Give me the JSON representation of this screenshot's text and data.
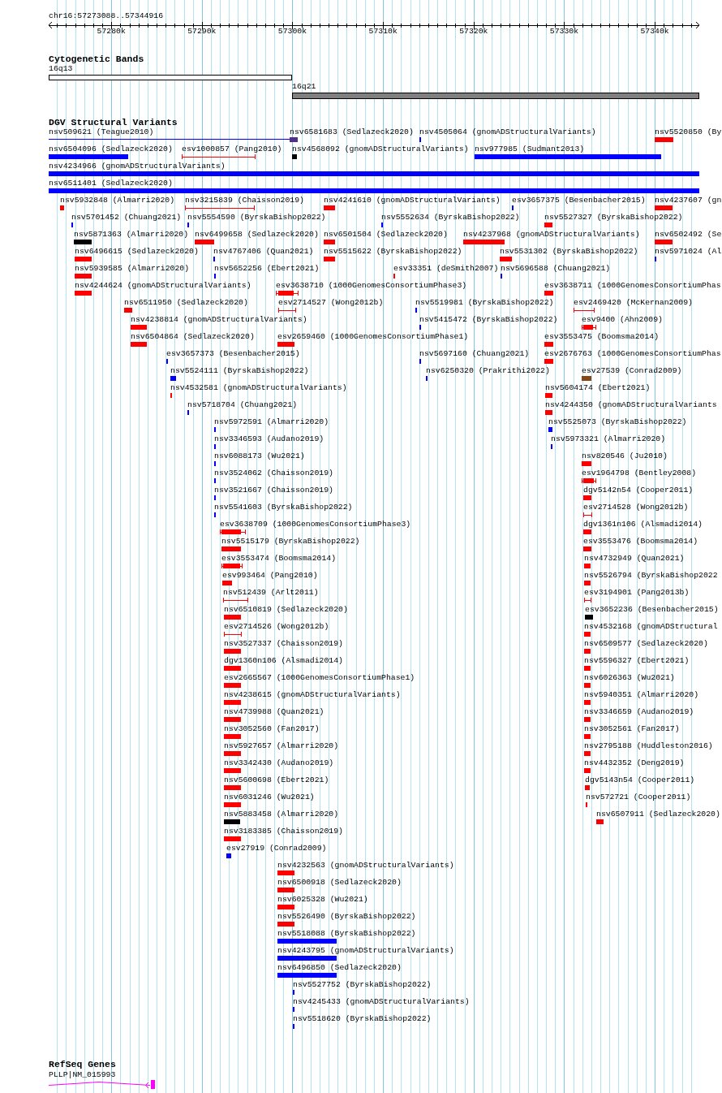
{
  "location": "chr16:57273088..57344916",
  "ruler": {
    "ticks": [
      "57280k",
      "57290k",
      "57300k",
      "57310k",
      "57320k",
      "57330k",
      "57340k"
    ]
  },
  "tracks": [
    {
      "kind": "bands",
      "title": "Cytogenetic Bands",
      "bands": [
        {
          "label": "16q13",
          "color": "#ffffff"
        },
        {
          "label": "16q21",
          "color": "#808080"
        }
      ]
    },
    {
      "kind": "variants",
      "title": "DGV Structural Variants",
      "features": [
        {
          "label": "nsv509621 (Teague2010)",
          "kind": "line",
          "color": "#0000ff"
        },
        {
          "label": "nsv6581683 (Sedlazeck2020)",
          "kind": "block",
          "color": "#50308c"
        },
        {
          "label": "nsv4505064 (gnomADStructuralVariants)",
          "kind": "block",
          "color": "#0000ff"
        },
        {
          "label": "nsv5520850 (By",
          "kind": "block",
          "color": "#ff0000"
        },
        {
          "label": "nsv6504096 (Sedlazeck2020)",
          "kind": "block",
          "color": "#0000ff"
        },
        {
          "label": "esv1000857 (Pang2010)",
          "kind": "interval",
          "color": "#ff0000"
        },
        {
          "label": "nsv4568092 (gnomADStructuralVariants)",
          "kind": "block",
          "color": "#000000"
        },
        {
          "label": "nsv977985 (Sudmant2013)",
          "kind": "block",
          "color": "#0000ff"
        },
        {
          "label": "nsv4234966 (gnomADStructuralVariants)",
          "kind": "block",
          "color": "#0000ff"
        },
        {
          "label": "nsv6511401 (Sedlazeck2020)",
          "kind": "block",
          "color": "#0000ff"
        },
        {
          "label": "nsv5932848 (Almarri2020)",
          "kind": "block",
          "color": "#ff0000"
        },
        {
          "label": "nsv3215839 (Chaisson2019)",
          "kind": "interval",
          "color": "#ff0000"
        },
        {
          "label": "nsv4241610 (gnomADStructuralVariants)",
          "kind": "block",
          "color": "#ff0000"
        },
        {
          "label": "esv3657375 (Besenbacher2015)",
          "kind": "block",
          "color": "#0000ff"
        },
        {
          "label": "nsv4237607 (gn",
          "kind": "block",
          "color": "#ff0000"
        },
        {
          "label": "nsv5701452 (Chuang2021)",
          "kind": "block",
          "color": "#0000ff"
        },
        {
          "label": "nsv5554590 (ByrskaBishop2022)",
          "kind": "block",
          "color": "#0000ff"
        },
        {
          "label": "nsv5552634 (ByrskaBishop2022)",
          "kind": "block",
          "color": "#0000ff"
        },
        {
          "label": "nsv5527327 (ByrskaBishop2022)",
          "kind": "block",
          "color": "#ff0000"
        },
        {
          "label": "nsv5871363 (Almarri2020)",
          "kind": "block",
          "color": "#000000"
        },
        {
          "label": "nsv6499658 (Sedlazeck2020)",
          "kind": "block",
          "color": "#ff0000"
        },
        {
          "label": "nsv6501504 (Sedlazeck2020)",
          "kind": "block",
          "color": "#ff0000"
        },
        {
          "label": "nsv4237968 (gnomADStructuralVariants)",
          "kind": "block",
          "color": "#ff0000"
        },
        {
          "label": "nsv6502492 (Se",
          "kind": "block",
          "color": "#ff0000"
        },
        {
          "label": "nsv6496615 (Sedlazeck2020)",
          "kind": "block",
          "color": "#ff0000"
        },
        {
          "label": "nsv4767406 (Quan2021)",
          "kind": "block",
          "color": "#0000ff"
        },
        {
          "label": "nsv5515622 (ByrskaBishop2022)",
          "kind": "block",
          "color": "#ff0000"
        },
        {
          "label": "nsv5531302 (ByrskaBishop2022)",
          "kind": "block",
          "color": "#ff0000"
        },
        {
          "label": "nsv5971024 (Al",
          "kind": "block",
          "color": "#0000ff"
        },
        {
          "label": "nsv5939585 (Almarri2020)",
          "kind": "block",
          "color": "#ff0000"
        },
        {
          "label": "nsv5652256 (Ebert2021)",
          "kind": "block",
          "color": "#0000ff"
        },
        {
          "label": "esv33351 (deSmith2007)",
          "kind": "block",
          "color": "#ff0000"
        },
        {
          "label": "nsv5696588 (Chuang2021)",
          "kind": "block",
          "color": "#0000ff"
        },
        {
          "label": "nsv4244624 (gnomADStructuralVariants)",
          "kind": "block",
          "color": "#ff0000"
        },
        {
          "label": "esv3638710 (1000GenomesConsortiumPhase3)",
          "kind": "whisker",
          "color": "#ff0000"
        },
        {
          "label": "esv3638711 (1000GenomesConsortiumPhas",
          "kind": "block",
          "color": "#ff0000"
        },
        {
          "label": "nsv6511950 (Sedlazeck2020)",
          "kind": "block",
          "color": "#ff0000"
        },
        {
          "label": "esv2714527 (Wong2012b)",
          "kind": "interval",
          "color": "#ff0000"
        },
        {
          "label": "nsv5519981 (ByrskaBishop2022)",
          "kind": "block",
          "color": "#0000ff"
        },
        {
          "label": "esv2469420 (McKernan2009)",
          "kind": "interval",
          "color": "#ff0000"
        },
        {
          "label": "nsv4238814 (gnomADStructuralVariants)",
          "kind": "block",
          "color": "#ff0000"
        },
        {
          "label": "nsv5415472 (ByrskaBishop2022)",
          "kind": "block",
          "color": "#0000ff"
        },
        {
          "label": "esv9400 (Ahn2009)",
          "kind": "whisker",
          "color": "#ff0000"
        },
        {
          "label": "nsv6504864 (Sedlazeck2020)",
          "kind": "block",
          "color": "#ff0000"
        },
        {
          "label": "esv2659460 (1000GenomesConsortiumPhase1)",
          "kind": "block",
          "color": "#ff0000"
        },
        {
          "label": "esv3553475 (Boomsma2014)",
          "kind": "block",
          "color": "#ff0000"
        },
        {
          "label": "esv3657373 (Besenbacher2015)",
          "kind": "block",
          "color": "#0000ff"
        },
        {
          "label": "nsv5697160 (Chuang2021)",
          "kind": "block",
          "color": "#0000ff"
        },
        {
          "label": "esv2676763 (1000GenomesConsortiumPhas",
          "kind": "block",
          "color": "#ff0000"
        },
        {
          "label": "nsv5524111 (ByrskaBishop2022)",
          "kind": "block",
          "color": "#0000ff"
        },
        {
          "label": "nsv6250320 (Prakrithi2022)",
          "kind": "block",
          "color": "#0000ff"
        },
        {
          "label": "esv27539 (Conrad2009)",
          "kind": "block",
          "color": "#8b4513"
        },
        {
          "label": "nsv4532581 (gnomADStructuralVariants)",
          "kind": "block",
          "color": "#ff0000"
        },
        {
          "label": "nsv5604174 (Ebert2021)",
          "kind": "block",
          "color": "#ff0000"
        },
        {
          "label": "nsv5718704 (Chuang2021)",
          "kind": "block",
          "color": "#0000ff"
        },
        {
          "label": "nsv4244350 (gnomADStructuralVariants",
          "kind": "block",
          "color": "#ff0000"
        },
        {
          "label": "nsv5972591 (Almarri2020)",
          "kind": "block",
          "color": "#0000ff"
        },
        {
          "label": "nsv5525073 (ByrskaBishop2022)",
          "kind": "block",
          "color": "#0000ff"
        },
        {
          "label": "nsv3346593 (Audano2019)",
          "kind": "block",
          "color": "#0000ff"
        },
        {
          "label": "nsv5973321 (Almarri2020)",
          "kind": "block",
          "color": "#0000ff"
        },
        {
          "label": "nsv6088173 (Wu2021)",
          "kind": "block",
          "color": "#0000ff"
        },
        {
          "label": "nsv820546 (Ju2010)",
          "kind": "block",
          "color": "#ff0000"
        },
        {
          "label": "nsv3524062 (Chaisson2019)",
          "kind": "block",
          "color": "#0000ff"
        },
        {
          "label": "esv1964798 (Bentley2008)",
          "kind": "whisker",
          "color": "#ff0000"
        },
        {
          "label": "nsv3521667 (Chaisson2019)",
          "kind": "block",
          "color": "#0000ff"
        },
        {
          "label": "dgv5142n54 (Cooper2011)",
          "kind": "block",
          "color": "#ff0000"
        },
        {
          "label": "nsv5541603 (ByrskaBishop2022)",
          "kind": "block",
          "color": "#0000ff"
        },
        {
          "label": "esv2714528 (Wong2012b)",
          "kind": "interval",
          "color": "#ff0000"
        },
        {
          "label": "esv3638709 (1000GenomesConsortiumPhase3)",
          "kind": "whisker",
          "color": "#ff0000"
        },
        {
          "label": "dgv1361n106 (Alsmadi2014)",
          "kind": "block",
          "color": "#ff0000"
        },
        {
          "label": "nsv5515179 (ByrskaBishop2022)",
          "kind": "block",
          "color": "#ff0000"
        },
        {
          "label": "esv3553476 (Boomsma2014)",
          "kind": "block",
          "color": "#ff0000"
        },
        {
          "label": "esv3553474 (Boomsma2014)",
          "kind": "whisker",
          "color": "#ff0000"
        },
        {
          "label": "nsv4732949 (Quan2021)",
          "kind": "block",
          "color": "#ff0000"
        },
        {
          "label": "esv993464 (Pang2010)",
          "kind": "block",
          "color": "#ff0000"
        },
        {
          "label": "nsv5526794 (ByrskaBishop2022",
          "kind": "block",
          "color": "#ff0000"
        },
        {
          "label": "nsv512439 (Arlt2011)",
          "kind": "interval",
          "color": "#ff0000"
        },
        {
          "label": "esv3194901 (Pang2013b)",
          "kind": "interval",
          "color": "#ff0000"
        },
        {
          "label": "nsv6510819 (Sedlazeck2020)",
          "kind": "block",
          "color": "#ff0000"
        },
        {
          "label": "esv3652236 (Besenbacher2015)",
          "kind": "block",
          "color": "#000000"
        },
        {
          "label": "esv2714526 (Wong2012b)",
          "kind": "interval",
          "color": "#ff0000"
        },
        {
          "label": "nsv4532168 (gnomADStructural",
          "kind": "block",
          "color": "#ff0000"
        },
        {
          "label": "nsv3527337 (Chaisson2019)",
          "kind": "block",
          "color": "#ff0000"
        },
        {
          "label": "nsv6509577 (Sedlazeck2020)",
          "kind": "block",
          "color": "#ff0000"
        },
        {
          "label": "dgv1360n106 (Alsmadi2014)",
          "kind": "block",
          "color": "#ff0000"
        },
        {
          "label": "nsv5596327 (Ebert2021)",
          "kind": "block",
          "color": "#ff0000"
        },
        {
          "label": "esv2665567 (1000GenomesConsortiumPhase1)",
          "kind": "block",
          "color": "#ff0000"
        },
        {
          "label": "nsv6026363 (Wu2021)",
          "kind": "block",
          "color": "#ff0000"
        },
        {
          "label": "nsv4238615 (gnomADStructuralVariants)",
          "kind": "block",
          "color": "#ff0000"
        },
        {
          "label": "nsv5940351 (Almarri2020)",
          "kind": "block",
          "color": "#ff0000"
        },
        {
          "label": "nsv4739988 (Quan2021)",
          "kind": "block",
          "color": "#ff0000"
        },
        {
          "label": "nsv3346659 (Audano2019)",
          "kind": "block",
          "color": "#ff0000"
        },
        {
          "label": "nsv3052560 (Fan2017)",
          "kind": "block",
          "color": "#ff0000"
        },
        {
          "label": "nsv3052561 (Fan2017)",
          "kind": "block",
          "color": "#ff0000"
        },
        {
          "label": "nsv5927657 (Almarri2020)",
          "kind": "block",
          "color": "#ff0000"
        },
        {
          "label": "nsv2795188 (Huddleston2016)",
          "kind": "block",
          "color": "#ff0000"
        },
        {
          "label": "nsv3342430 (Audano2019)",
          "kind": "block",
          "color": "#ff0000"
        },
        {
          "label": "nsv4432352 (Deng2019)",
          "kind": "block",
          "color": "#ff0000"
        },
        {
          "label": "nsv5600698 (Ebert2021)",
          "kind": "block",
          "color": "#ff0000"
        },
        {
          "label": "dgv5143n54 (Cooper2011)",
          "kind": "block",
          "color": "#ff0000"
        },
        {
          "label": "nsv6031246 (Wu2021)",
          "kind": "block",
          "color": "#ff0000"
        },
        {
          "label": "nsv572721 (Cooper2011)",
          "kind": "block",
          "color": "#ff0000"
        },
        {
          "label": "nsv5883458 (Almarri2020)",
          "kind": "block",
          "color": "#000000"
        },
        {
          "label": "nsv6507911 (Sedlazeck2020)",
          "kind": "block",
          "color": "#ff0000"
        },
        {
          "label": "nsv3183385 (Chaisson2019)",
          "kind": "block",
          "color": "#ff0000"
        },
        {
          "label": "esv27919 (Conrad2009)",
          "kind": "block",
          "color": "#0000ff"
        },
        {
          "label": "nsv4232563 (gnomADStructuralVariants)",
          "kind": "block",
          "color": "#ff0000"
        },
        {
          "label": "nsv6500918 (Sedlazeck2020)",
          "kind": "block",
          "color": "#ff0000"
        },
        {
          "label": "nsv6025328 (Wu2021)",
          "kind": "block",
          "color": "#ff0000"
        },
        {
          "label": "nsv5526490 (ByrskaBishop2022)",
          "kind": "block",
          "color": "#ff0000"
        },
        {
          "label": "nsv5518088 (ByrskaBishop2022)",
          "kind": "block",
          "color": "#0000ff"
        },
        {
          "label": "nsv4243795 (gnomADStructuralVariants)",
          "kind": "block",
          "color": "#0000ff"
        },
        {
          "label": "nsv6496850 (Sedlazeck2020)",
          "kind": "block",
          "color": "#0000ff"
        },
        {
          "label": "nsv5527752 (ByrskaBishop2022)",
          "kind": "block",
          "color": "#0000ff"
        },
        {
          "label": "nsv4245433 (gnomADStructuralVariants)",
          "kind": "block",
          "color": "#0000ff"
        },
        {
          "label": "nsv5518620 (ByrskaBishop2022)",
          "kind": "block",
          "color": "#0000ff"
        }
      ]
    },
    {
      "kind": "genes",
      "title": "RefSeq Genes",
      "genes": [
        {
          "label": "PLLP|NM_015993"
        }
      ]
    }
  ]
}
